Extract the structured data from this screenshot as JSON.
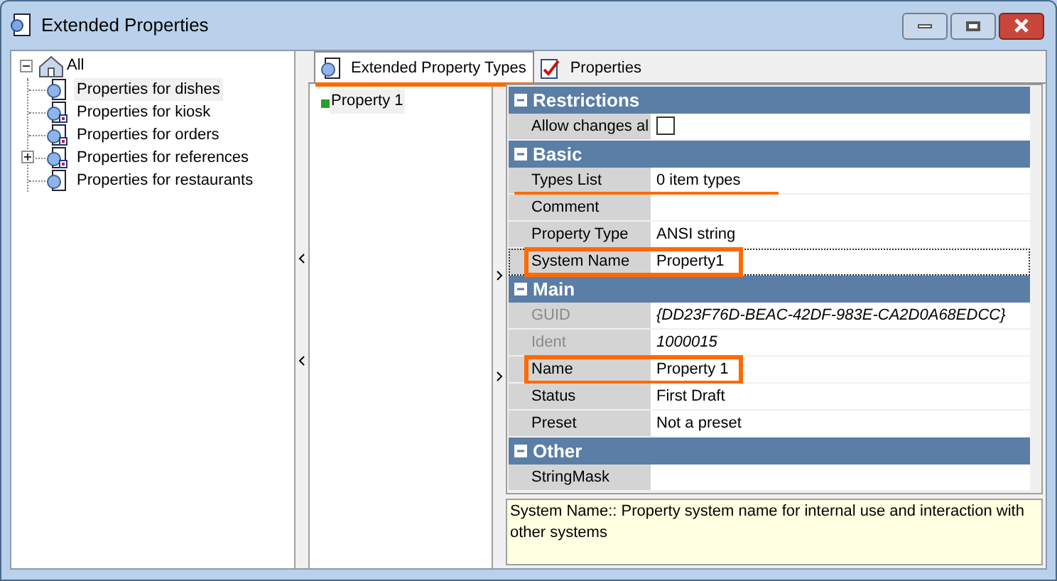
{
  "window": {
    "title": "Extended Properties"
  },
  "tree": {
    "label": "All",
    "expanded": true,
    "children": [
      {
        "label": "Properties for dishes",
        "selected": true,
        "badge": false,
        "expandable": false
      },
      {
        "label": "Properties for kiosk",
        "selected": false,
        "badge": true,
        "expandable": false
      },
      {
        "label": "Properties for orders",
        "selected": false,
        "badge": true,
        "expandable": false
      },
      {
        "label": "Properties for references",
        "selected": false,
        "badge": true,
        "expandable": true
      },
      {
        "label": "Properties for restaurants",
        "selected": false,
        "badge": false,
        "expandable": false
      }
    ]
  },
  "tabs": [
    {
      "label": "Extended Property Types",
      "selected": true,
      "underlined": true
    },
    {
      "label": "Properties",
      "selected": false,
      "underlined": false
    }
  ],
  "type_list": [
    {
      "label": "Property 1",
      "selected": true
    }
  ],
  "grid": [
    {
      "kind": "header",
      "label": "Restrictions",
      "expanded": true
    },
    {
      "kind": "checkbox",
      "label": "Allow changes al",
      "checked": false
    },
    {
      "kind": "header",
      "label": "Basic",
      "expanded": true
    },
    {
      "kind": "property",
      "label": "Types List",
      "value": "0 item types",
      "disabled": false,
      "selected": false,
      "outlined": false,
      "underlined": true
    },
    {
      "kind": "property",
      "label": "Comment",
      "disabled": false,
      "selected": false,
      "outlined": false,
      "underlined": false
    },
    {
      "kind": "property",
      "label": "Property Type",
      "value": "ANSI string",
      "disabled": false,
      "selected": false,
      "outlined": false,
      "underlined": false
    },
    {
      "kind": "property",
      "label": "System Name",
      "value": "Property1",
      "disabled": false,
      "selected": true,
      "outlined": true,
      "underlined": false
    },
    {
      "kind": "header",
      "label": "Main",
      "expanded": true
    },
    {
      "kind": "property",
      "label": "GUID",
      "value": "{DD23F76D-BEAC-42DF-983E-CA2D0A68EDCC}",
      "disabled": true,
      "selected": false,
      "outlined": false,
      "underlined": false
    },
    {
      "kind": "property",
      "label": "Ident",
      "value": "1000015",
      "disabled": true,
      "selected": false,
      "outlined": false,
      "underlined": false
    },
    {
      "kind": "property",
      "label": "Name",
      "value": "Property 1",
      "disabled": false,
      "selected": false,
      "outlined": true,
      "underlined": false
    },
    {
      "kind": "property",
      "label": "Status",
      "value": "First Draft",
      "disabled": false,
      "selected": false,
      "outlined": false,
      "underlined": false
    },
    {
      "kind": "property",
      "label": "Preset",
      "value": "Not a preset",
      "disabled": false,
      "selected": false,
      "outlined": false,
      "underlined": false
    },
    {
      "kind": "header",
      "label": "Other",
      "expanded": true
    },
    {
      "kind": "property",
      "label": "StringMask",
      "disabled": false,
      "selected": false,
      "outlined": false,
      "underlined": false
    }
  ],
  "description": "System Name:: Property system name for internal use and interaction with other systems"
}
